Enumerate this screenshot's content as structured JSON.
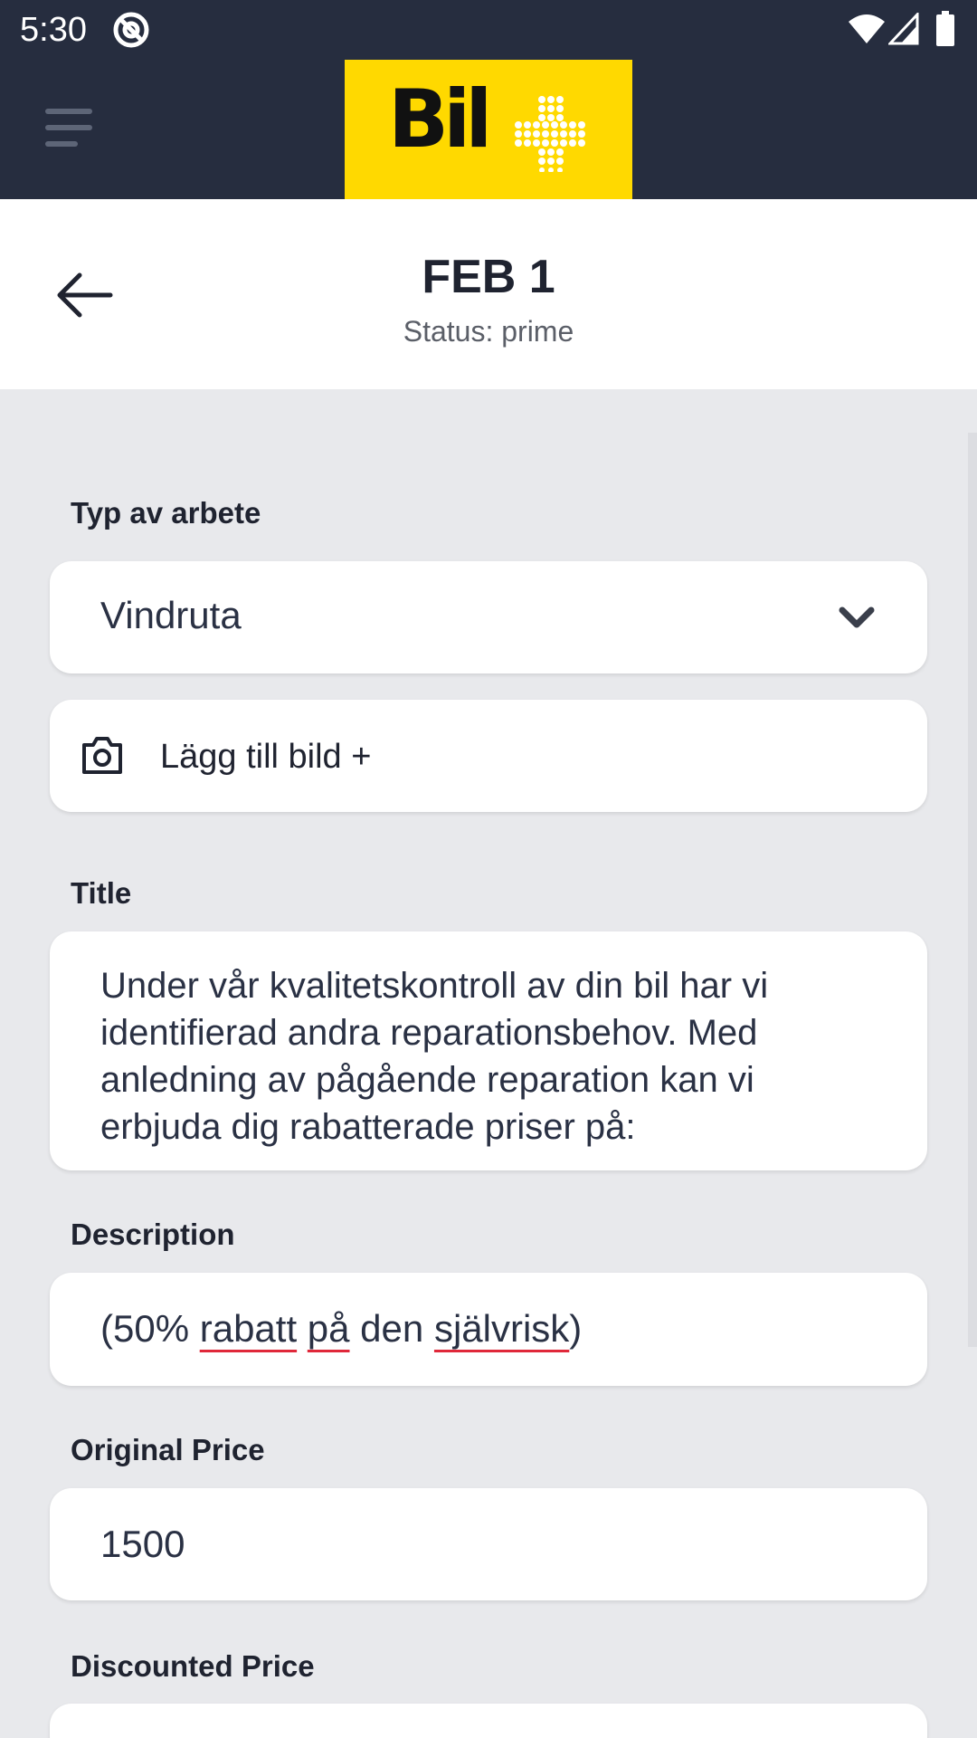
{
  "status_bar": {
    "time": "5:30"
  },
  "app_bar": {
    "logo_text": "Bil"
  },
  "header": {
    "title": "FEB 1",
    "status": "Status: prime"
  },
  "form": {
    "work_type": {
      "label": "Typ av arbete",
      "value": "Vindruta"
    },
    "add_image": {
      "label": "Lägg till bild +"
    },
    "title": {
      "label": "Title",
      "value": "Under vår kvalitetskontroll av din bil har vi identifierad andra reparationsbehov. Med anledning av pågående reparation kan vi erbjuda dig rabatterade priser på:"
    },
    "description": {
      "label": "Description",
      "value_parts": [
        "(50% ",
        "rabatt",
        " ",
        "på",
        " den ",
        "självrisk",
        ")"
      ]
    },
    "original_price": {
      "label": "Original Price",
      "value": "1500"
    },
    "discounted_price": {
      "label": "Discounted Price"
    }
  },
  "colors": {
    "app_bar": "#262d3f",
    "logo_bg": "#ffd900",
    "spellcheck": "#e0283a",
    "background": "#e8e9ec"
  }
}
